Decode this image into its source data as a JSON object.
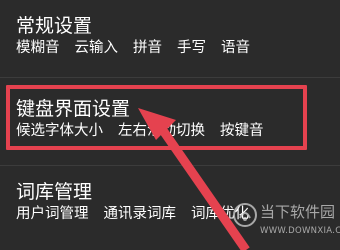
{
  "colors": {
    "background": "#2b2b2b",
    "text": "#ffffff",
    "highlight": "#e5424f",
    "divider": "#3c3c3c"
  },
  "sections": [
    {
      "title": "常规设置",
      "options": [
        "模糊音",
        "云输入",
        "拼音",
        "手写",
        "语音"
      ]
    },
    {
      "title": "键盘界面设置",
      "options": [
        "候选字体大小",
        "左右滑动切换",
        "按键音"
      ]
    },
    {
      "title": "词库管理",
      "options": [
        "用户词管理",
        "通讯录词库",
        "词库优化"
      ]
    }
  ],
  "annotation": {
    "box_color": "#e5424f",
    "arrow_color": "#e5424f"
  },
  "watermark": {
    "name": "当下软件园",
    "url": "WWW.DOWNXIA.COM"
  }
}
